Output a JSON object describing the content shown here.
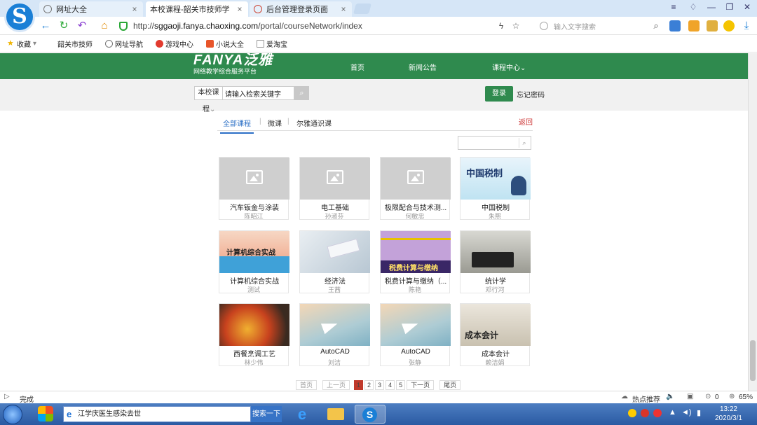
{
  "browser": {
    "tabs": [
      {
        "label": "网址大全"
      },
      {
        "label": "本校课程-韶关市技师学"
      },
      {
        "label": "后台管理登录页面"
      }
    ],
    "url_prefix": "http://",
    "url_host": "sggaoji.fanya.chaoxing.com",
    "url_path": "/portal/courseNetwork/index",
    "search_placeholder": "输入文字搜索",
    "bookmarks": [
      {
        "label": "收藏",
        "icon": "star-icon"
      },
      {
        "label": "韶关市技师",
        "icon": "page-icon"
      },
      {
        "label": "网址导航",
        "icon": "globe-icon"
      },
      {
        "label": "游戏中心",
        "icon": "game-icon"
      },
      {
        "label": "小说大全",
        "icon": "book-icon"
      },
      {
        "label": "爱淘宝",
        "icon": "page-icon"
      }
    ],
    "status_left": "完成",
    "status_hot": "热点推荐",
    "status_count": "0",
    "zoom": "65%"
  },
  "site": {
    "brand_main": "FANYA泛雅",
    "brand_sub": "网络教学综合服务平台",
    "nav": [
      "首页",
      "新闻公告",
      "课程中心"
    ],
    "scope_label": "本校课",
    "scope_label_wrap": "程",
    "search_placeholder": "请输入检索关键字",
    "login": "登录",
    "forgot": "忘记密码"
  },
  "main": {
    "tabs": [
      "全部课程",
      "微课",
      "尔雅通识课"
    ],
    "back": "返回",
    "courses": [
      {
        "title": "汽车钣金与涂装",
        "teacher": "陈昭江",
        "thumb": "placeholder"
      },
      {
        "title": "电工基础",
        "teacher": "孙淑芬",
        "thumb": "placeholder"
      },
      {
        "title": "极限配合与技术测...",
        "teacher": "何敏忠",
        "thumb": "placeholder"
      },
      {
        "title": "中国税制",
        "teacher": "朱熙",
        "thumb": "tax",
        "thumb_text": "中国税制"
      },
      {
        "title": "计算机综合实战",
        "teacher": "测试",
        "thumb": "computer",
        "thumb_text": "计算机综合实战"
      },
      {
        "title": "经济法",
        "teacher": "王茜",
        "thumb": "desk"
      },
      {
        "title": "税费计算与缴纳（...",
        "teacher": "陈艳",
        "thumb": "book",
        "thumb_text": "税费计算与缴纳"
      },
      {
        "title": "统计学",
        "teacher": "邓行河",
        "thumb": "calc"
      },
      {
        "title": "西餐烹调工艺",
        "teacher": "林少伟",
        "thumb": "food"
      },
      {
        "title": "AutoCAD",
        "teacher": "刘洁",
        "thumb": "plane"
      },
      {
        "title": "AutoCAD",
        "teacher": "张静",
        "thumb": "plane"
      },
      {
        "title": "成本会计",
        "teacher": "赖洁娟",
        "thumb": "accounting",
        "thumb_text": "成本会计"
      }
    ],
    "pager": {
      "first": "首页",
      "prev": "上一页",
      "pages": [
        "1",
        "2",
        "3",
        "4",
        "5"
      ],
      "current": "1",
      "next": "下一页",
      "last": "尾页"
    }
  },
  "taskbar": {
    "search_text": "江学庆医生感染去世",
    "search_button": "搜索一下",
    "time": "13:22",
    "date": "2020/3/1"
  },
  "colors": {
    "brand_green": "#2f8a4e",
    "link_blue": "#2b6fc6",
    "pager_red": "#c0392b"
  }
}
